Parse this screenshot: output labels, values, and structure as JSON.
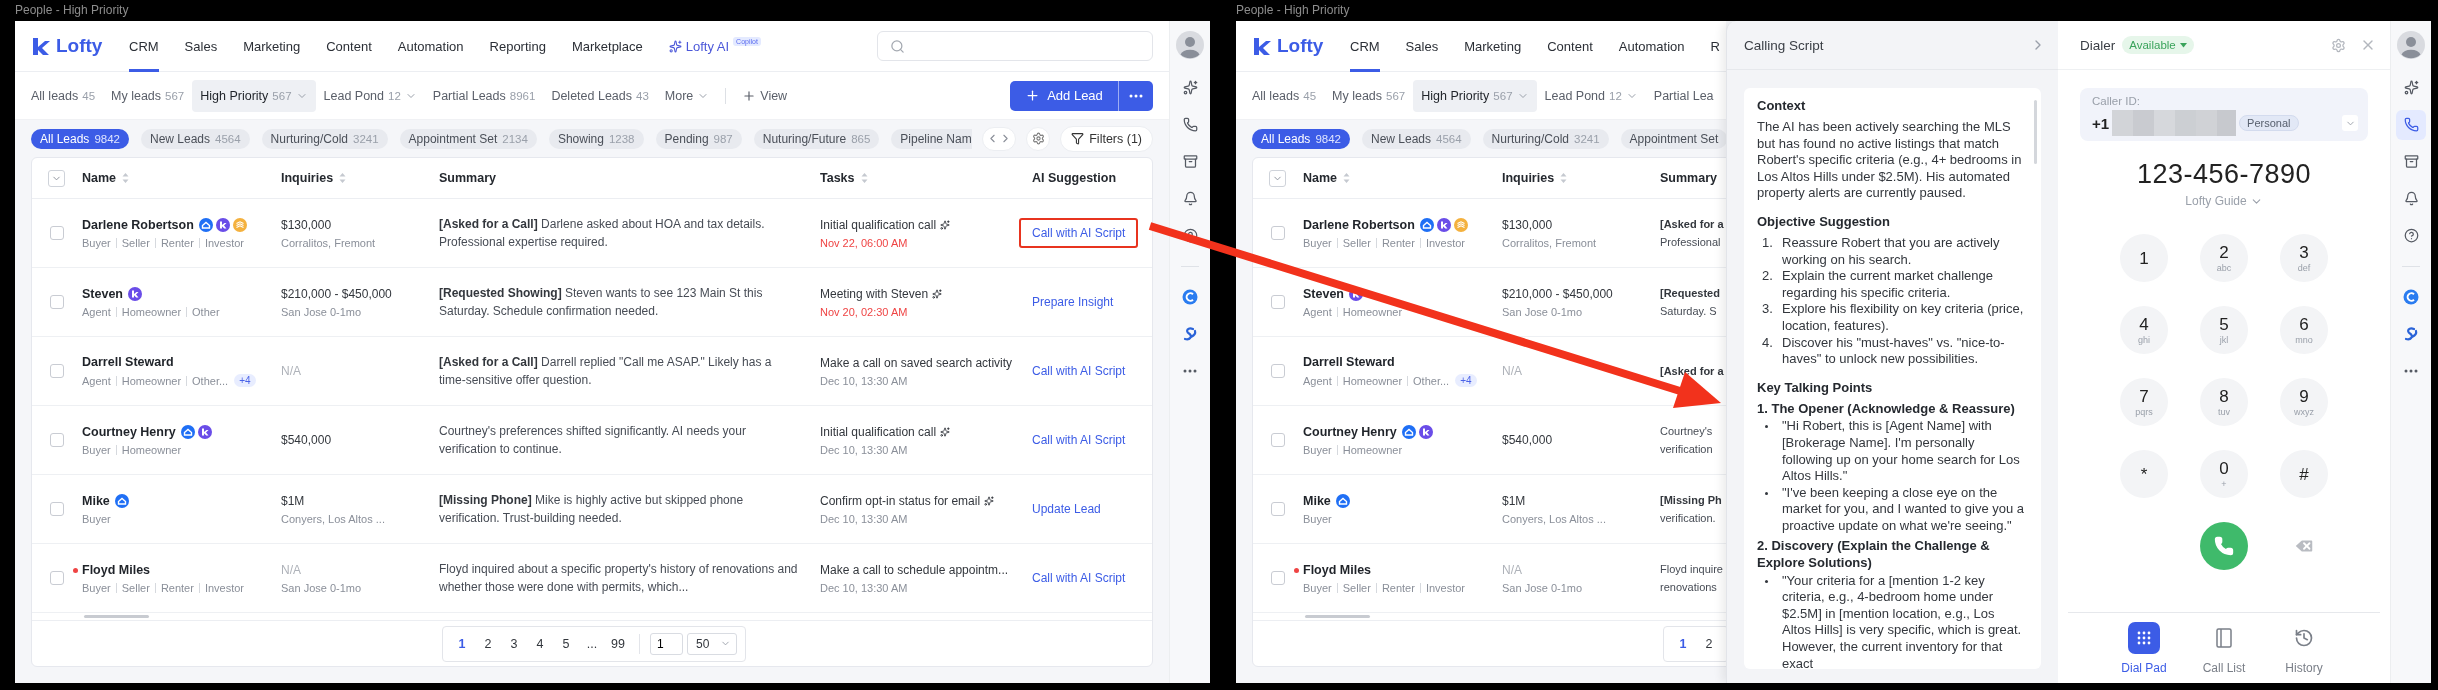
{
  "left_window": {
    "caption": "People - High Priority",
    "crm": {
      "logo": "Lofty",
      "nav": [
        {
          "label": "CRM",
          "kind": "link",
          "selected": true
        },
        {
          "label": "Sales",
          "kind": "link",
          "selected": false
        },
        {
          "label": "Marketing",
          "kind": "link",
          "selected": false
        },
        {
          "label": "Content",
          "kind": "link",
          "selected": false
        },
        {
          "label": "Automation",
          "kind": "link",
          "selected": false
        },
        {
          "label": "Reporting",
          "kind": "link",
          "selected": false
        },
        {
          "label": "Marketplace",
          "kind": "link",
          "selected": false
        },
        {
          "label": "Lofty AI",
          "kind": "ai",
          "badge": "Copilot",
          "selected": false
        }
      ],
      "search_field": true,
      "views": [
        {
          "label": "All leads",
          "count": "45",
          "selected": false,
          "dropdown": false
        },
        {
          "label": "My leads",
          "count": "567",
          "selected": false,
          "dropdown": false
        },
        {
          "label": "High Priority",
          "count": "567",
          "selected": true,
          "dropdown": true
        },
        {
          "label": "Lead Pond",
          "count": "12",
          "selected": false,
          "dropdown": true
        },
        {
          "label": "Partial Leads",
          "count": "8961",
          "selected": false,
          "dropdown": false
        },
        {
          "label": "Deleted Leads",
          "count": "43",
          "selected": false,
          "dropdown": false
        },
        {
          "label": "More",
          "selected": false,
          "dropdown": true
        }
      ],
      "add_view": "View",
      "add_lead": "Add Lead",
      "chips": [
        {
          "label": "All Leads",
          "count": "9842",
          "selected": true
        },
        {
          "label": "New Leads",
          "count": "4564",
          "selected": false
        },
        {
          "label": "Nurturing/Cold",
          "count": "3241",
          "selected": false
        },
        {
          "label": "Appointment Set",
          "count": "2134",
          "selected": false
        },
        {
          "label": "Showing",
          "count": "1238",
          "selected": false
        },
        {
          "label": "Pending",
          "count": "987",
          "selected": false
        },
        {
          "label": "Nuturing/Future",
          "count": "865",
          "selected": false
        },
        {
          "label": "Pipeline Nam",
          "selected": false
        }
      ],
      "chip_tools": true,
      "filters": "Filters (1)",
      "table": {
        "select_all": true,
        "columns": [
          {
            "label": "Name",
            "sortable": true
          },
          {
            "label": "Inquiries",
            "sortable": true
          },
          {
            "label": "Summary",
            "sortable": false
          },
          {
            "label": "Tasks",
            "sortable": true
          },
          {
            "label": "AI Suggestion",
            "sortable": false
          }
        ],
        "rows": [
          {
            "checked": false,
            "unread": false,
            "name": "Darlene Robertson",
            "badges": [
              {
                "kind": "home"
              },
              {
                "kind": "lofty"
              },
              {
                "kind": "layers"
              }
            ],
            "tags": [
              "Buyer",
              "Seller",
              "Renter",
              "Investor"
            ],
            "inquiry": "$130,000",
            "inquiry_muted": false,
            "location": "Corralitos, Fremont",
            "summary": "**[Asked for a Call]** Darlene asked about HOA and tax details. Professional expertise required.",
            "task": "Initial qualification call",
            "task_ai": true,
            "due": "Nov 22, 06:00 AM",
            "overdue": true,
            "action": {
              "label": "Call with AI Script",
              "highlighted": true
            }
          },
          {
            "checked": false,
            "unread": false,
            "name": "Steven",
            "badges": [
              {
                "kind": "lofty"
              }
            ],
            "tags": [
              "Agent",
              "Homeowner",
              "Other"
            ],
            "inquiry": "$210,000 - $450,000",
            "inquiry_muted": false,
            "location": "San Jose 0-1mo",
            "summary": "**[Requested Showing]** Steven wants to see 123 Main St this Saturday. Schedule confirmation needed.",
            "task": "Meeting with Steven",
            "task_ai": true,
            "due": "Nov 20, 02:30 AM",
            "overdue": true,
            "action": {
              "label": "Prepare Insight",
              "highlighted": false
            }
          },
          {
            "checked": false,
            "unread": false,
            "name": "Darrell Steward",
            "badges": [],
            "tags": [
              "Agent",
              "Homeowner",
              "Other..."
            ],
            "extra_tags": "+4",
            "inquiry": "N/A",
            "inquiry_muted": true,
            "summary": "**[Asked for a Call]** Darrell replied \"Call me ASAP.\" Likely has a time-sensitive offer question.",
            "task": "Make a call on saved search activity",
            "task_ai": false,
            "due": "Dec 10, 13:30 AM",
            "overdue": false,
            "action": {
              "label": "Call with AI Script",
              "highlighted": false
            }
          },
          {
            "checked": false,
            "unread": false,
            "name": "Courtney Henry",
            "badges": [
              {
                "kind": "home"
              },
              {
                "kind": "lofty"
              }
            ],
            "tags": [
              "Buyer",
              "Homeowner"
            ],
            "inquiry": "$540,000",
            "inquiry_muted": false,
            "summary": "Courtney's preferences shifted significantly. AI needs your verification to continue.",
            "task": "Initial qualification call",
            "task_ai": true,
            "due": "Dec 10, 13:30 AM",
            "overdue": false,
            "action": {
              "label": "Call with AI Script",
              "highlighted": false
            }
          },
          {
            "checked": false,
            "unread": false,
            "name": "Mike",
            "badges": [
              {
                "kind": "home"
              }
            ],
            "tags": [
              "Buyer"
            ],
            "inquiry": "$1M",
            "inquiry_muted": false,
            "location": "Conyers, Los Altos ...",
            "summary": "**[Missing Phone]** Mike is highly active but skipped phone verification. Trust-building needed.",
            "task": "Confirm opt-in status for email",
            "task_ai": true,
            "due": "Dec 10, 13:30 AM",
            "overdue": false,
            "action": {
              "label": "Update Lead",
              "highlighted": false
            }
          },
          {
            "checked": false,
            "unread": true,
            "name": "Floyd Miles",
            "badges": [],
            "tags": [
              "Buyer",
              "Seller",
              "Renter",
              "Investor"
            ],
            "inquiry": "N/A",
            "inquiry_muted": true,
            "location": "San Jose 0-1mo",
            "summary": "Floyd inquired about a specific property's history of renovations and whether those were done with permits, which...",
            "task": "Make a call to schedule appointm...",
            "task_ai": false,
            "due": "Dec 10, 13:30 AM",
            "overdue": false,
            "action": {
              "label": "Call with AI Script",
              "highlighted": false
            }
          }
        ],
        "pagination": {
          "pages": [
            {
              "label": "1",
              "selected": true
            },
            {
              "label": "2",
              "selected": false
            },
            {
              "label": "3",
              "selected": false
            },
            {
              "label": "4",
              "selected": false
            },
            {
              "label": "5",
              "selected": false
            },
            {
              "label": "...",
              "selected": false
            },
            {
              "label": "99",
              "selected": false
            }
          ],
          "page_input": "1",
          "page_size": "50"
        }
      }
    },
    "rail": [
      {
        "kind": "avatar",
        "selected": false
      },
      {
        "kind": "sparkle",
        "selected": false
      },
      {
        "kind": "phone",
        "selected": false
      },
      {
        "kind": "inbox",
        "selected": false
      },
      {
        "kind": "bell",
        "selected": false
      },
      {
        "kind": "help",
        "selected": false
      },
      {
        "kind": "divider",
        "selected": false
      },
      {
        "kind": "circle-logo",
        "selected": false
      },
      {
        "kind": "swirl-logo",
        "selected": false
      },
      {
        "kind": "more",
        "selected": false
      }
    ]
  },
  "right_window": {
    "caption": "People - High Priority",
    "crm": {
      "logo": "Lofty",
      "nav": [
        {
          "label": "CRM",
          "kind": "link",
          "selected": true
        },
        {
          "label": "Sales",
          "kind": "link",
          "selected": false
        },
        {
          "label": "Marketing",
          "kind": "link",
          "selected": false
        },
        {
          "label": "Content",
          "kind": "link",
          "selected": false
        },
        {
          "label": "Automation",
          "kind": "link",
          "selected": false
        },
        {
          "label": "R",
          "kind": "link",
          "selected": false
        }
      ],
      "views": [
        {
          "label": "All leads",
          "count": "45",
          "selected": false,
          "dropdown": false
        },
        {
          "label": "My leads",
          "count": "567",
          "selected": false,
          "dropdown": false
        },
        {
          "label": "High Priority",
          "count": "567",
          "selected": true,
          "dropdown": true
        },
        {
          "label": "Lead Pond",
          "count": "12",
          "selected": false,
          "dropdown": true
        },
        {
          "label": "Partial Lea",
          "selected": false,
          "dropdown": false
        }
      ],
      "chips": [
        {
          "label": "All Leads",
          "count": "9842",
          "selected": true
        },
        {
          "label": "New Leads",
          "count": "4564",
          "selected": false
        },
        {
          "label": "Nurturing/Cold",
          "count": "3241",
          "selected": false
        },
        {
          "label": "Appointment Set",
          "selected": false
        }
      ],
      "table": {
        "select_all": true,
        "columns": [
          {
            "label": "Name",
            "sortable": true
          },
          {
            "label": "Inquiries",
            "sortable": true
          },
          {
            "label": "Summary",
            "sortable": false
          }
        ],
        "rows": [
          {
            "checked": false,
            "unread": false,
            "name": "Darlene Robertson",
            "badges": [
              {
                "kind": "home"
              },
              {
                "kind": "lofty"
              },
              {
                "kind": "layers"
              }
            ],
            "tags": [
              "Buyer",
              "Seller",
              "Renter",
              "Investor"
            ],
            "inquiry": "$130,000",
            "inquiry_muted": false,
            "location": "Corralitos, Fremont",
            "summary_lines": [
              "**[Asked for a**",
              "Professional"
            ]
          },
          {
            "checked": false,
            "unread": false,
            "name": "Steven",
            "badges": [
              {
                "kind": "lofty"
              }
            ],
            "tags": [
              "Agent",
              "Homeowner"
            ],
            "inquiry": "$210,000 - $450,000",
            "inquiry_muted": false,
            "location": "San Jose 0-1mo",
            "summary_lines": [
              "**[Requested**",
              "Saturday. S"
            ]
          },
          {
            "checked": false,
            "unread": false,
            "name": "Darrell Steward",
            "badges": [],
            "tags": [
              "Agent",
              "Homeowner",
              "Other..."
            ],
            "extra_tags": "+4",
            "inquiry": "N/A",
            "inquiry_muted": true,
            "summary_lines": [
              "**[Asked for a**"
            ]
          },
          {
            "checked": false,
            "unread": false,
            "name": "Courtney Henry",
            "badges": [
              {
                "kind": "home"
              },
              {
                "kind": "lofty"
              }
            ],
            "tags": [
              "Buyer",
              "Homeowner"
            ],
            "inquiry": "$540,000",
            "inquiry_muted": false,
            "summary_lines": [
              "Courtney's",
              "verification"
            ]
          },
          {
            "checked": false,
            "unread": false,
            "name": "Mike",
            "badges": [
              {
                "kind": "home"
              }
            ],
            "tags": [
              "Buyer"
            ],
            "inquiry": "$1M",
            "inquiry_muted": false,
            "location": "Conyers, Los Altos ...",
            "summary_lines": [
              "**[Missing Ph**",
              "verification."
            ]
          },
          {
            "checked": false,
            "unread": true,
            "name": "Floyd Miles",
            "badges": [],
            "tags": [
              "Buyer",
              "Seller",
              "Renter",
              "Investor"
            ],
            "inquiry": "N/A",
            "inquiry_muted": true,
            "location": "San Jose 0-1mo",
            "summary_lines": [
              "Floyd inquire",
              "renovations"
            ]
          }
        ],
        "pagination": {
          "pages": [
            {
              "label": "1",
              "selected": true
            },
            {
              "label": "2",
              "selected": false
            }
          ]
        }
      }
    },
    "calling_script": {
      "title": "Calling Script",
      "sections": [
        {
          "heading": "Context",
          "blocks": [
            {
              "kind": "paragraph",
              "text": "The AI has been actively searching the MLS but has found no active listings that match Robert's specific criteria (e.g., 4+ bedrooms in Los Altos Hills under $2.5M). His automated property alerts are currently paused."
            }
          ]
        },
        {
          "heading": "Objective Suggestion",
          "blocks": [
            {
              "kind": "ordered",
              "items": [
                {
                  "number": "1.",
                  "text": "Reassure Robert that you are actively working on his search."
                },
                {
                  "number": "2.",
                  "text": "Explain the current market challenge regarding his specific criteria."
                },
                {
                  "number": "3.",
                  "text": "Explore his flexibility on key criteria (price, location, features)."
                },
                {
                  "number": "4.",
                  "text": "Discover his \"must-haves\" vs. \"nice-to-haves\" to unlock new possibilities."
                }
              ]
            }
          ]
        },
        {
          "heading": "Key Talking Points",
          "blocks": [
            {
              "kind": "subheading",
              "text": "1. The Opener (Acknowledge & Reassure)"
            },
            {
              "kind": "bullets",
              "items": [
                "\"Hi Robert, this is [Agent Name] with [Brokerage Name]. I'm personally following up on your home search for Los Altos Hills.\"",
                "\"I've been keeping a close eye on the market for you, and I wanted to give you a proactive update on what we're seeing.\""
              ]
            },
            {
              "kind": "subheading",
              "text": "2. Discovery (Explain the Challenge & Explore Solutions)"
            },
            {
              "kind": "bullets",
              "items": [
                "\"Your criteria for a [mention 1-2 key criteria, e.g., 4-bedroom home under $2.5M] in [mention location, e.g., Los Altos Hills] is very specific, which is great. However, the current inventory for that exact"
              ]
            }
          ]
        }
      ]
    },
    "dialer": {
      "title": "Dialer",
      "status": "Available",
      "caller_id": {
        "label": "Caller ID:",
        "country_code": "+1",
        "number_hidden": true,
        "tag": "Personal"
      },
      "number": "123-456-7890",
      "line": "Lofty Guide",
      "keys": [
        {
          "digit": "1"
        },
        {
          "digit": "2",
          "letters": "abc"
        },
        {
          "digit": "3",
          "letters": "def"
        },
        {
          "digit": "4",
          "letters": "ghi"
        },
        {
          "digit": "5",
          "letters": "jkl"
        },
        {
          "digit": "6",
          "letters": "mno"
        },
        {
          "digit": "7",
          "letters": "pqrs"
        },
        {
          "digit": "8",
          "letters": "tuv"
        },
        {
          "digit": "9",
          "letters": "wxyz"
        },
        {
          "digit": "*"
        },
        {
          "digit": "0",
          "letters": "+"
        },
        {
          "digit": "#"
        }
      ],
      "tabs": [
        {
          "label": "Dial Pad",
          "kind": "dialpad",
          "selected": true
        },
        {
          "label": "Call List",
          "kind": "list",
          "selected": false
        },
        {
          "label": "History",
          "kind": "history",
          "selected": false
        }
      ]
    },
    "rail": [
      {
        "kind": "avatar",
        "selected": false
      },
      {
        "kind": "sparkle",
        "selected": false
      },
      {
        "kind": "phone",
        "selected": true
      },
      {
        "kind": "inbox",
        "selected": false
      },
      {
        "kind": "bell",
        "selected": false
      },
      {
        "kind": "help",
        "selected": false
      },
      {
        "kind": "divider",
        "selected": false
      },
      {
        "kind": "circle-logo",
        "selected": false
      },
      {
        "kind": "swirl-logo",
        "selected": false
      },
      {
        "kind": "more",
        "selected": false
      }
    ]
  }
}
